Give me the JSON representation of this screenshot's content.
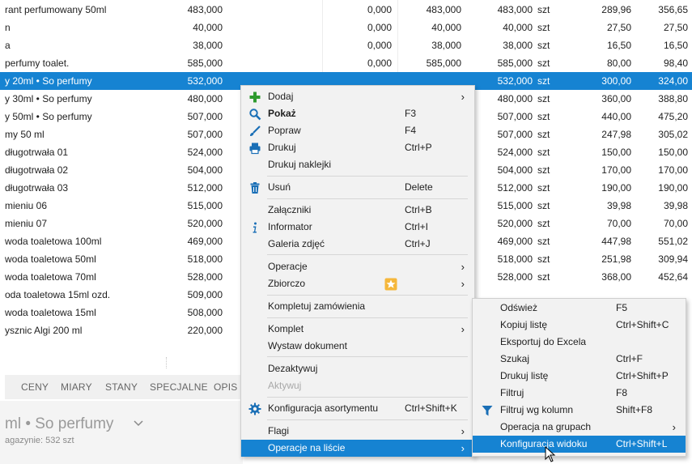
{
  "rows": [
    {
      "name": "rant perfumowany 50ml",
      "a": "483,000",
      "b": "0,000",
      "c": "483,000",
      "d": "483,000",
      "unit": "szt",
      "e": "289,96",
      "f": "356,65"
    },
    {
      "name": "n",
      "a": "40,000",
      "b": "0,000",
      "c": "40,000",
      "d": "40,000",
      "unit": "szt",
      "e": "27,50",
      "f": "27,50"
    },
    {
      "name": "a",
      "a": "38,000",
      "b": "0,000",
      "c": "38,000",
      "d": "38,000",
      "unit": "szt",
      "e": "16,50",
      "f": "16,50"
    },
    {
      "name": " perfumy toalet.",
      "a": "585,000",
      "b": "0,000",
      "c": "585,000",
      "d": "585,000",
      "unit": "szt",
      "e": "80,00",
      "f": "98,40"
    },
    {
      "name": "y 20ml  • So perfumy",
      "a": "532,000",
      "b": "",
      "c": "",
      "d": "532,000",
      "unit": "szt",
      "e": "300,00",
      "f": "324,00"
    },
    {
      "name": "y 30ml  • So perfumy",
      "a": "480,000",
      "b": "",
      "c": "",
      "d": "480,000",
      "unit": "szt",
      "e": "360,00",
      "f": "388,80"
    },
    {
      "name": "y 50ml  • So perfumy",
      "a": "507,000",
      "b": "",
      "c": "",
      "d": "507,000",
      "unit": "szt",
      "e": "440,00",
      "f": "475,20"
    },
    {
      "name": "my 50 ml",
      "a": "507,000",
      "b": "",
      "c": "",
      "d": "507,000",
      "unit": "szt",
      "e": "247,98",
      "f": "305,02"
    },
    {
      "name": "długotrwała 01",
      "a": "524,000",
      "b": "",
      "c": "",
      "d": "524,000",
      "unit": "szt",
      "e": "150,00",
      "f": "150,00"
    },
    {
      "name": "długotrwała 02",
      "a": "504,000",
      "b": "",
      "c": "",
      "d": "504,000",
      "unit": "szt",
      "e": "170,00",
      "f": "170,00"
    },
    {
      "name": "długotrwała 03",
      "a": "512,000",
      "b": "",
      "c": "",
      "d": "512,000",
      "unit": "szt",
      "e": "190,00",
      "f": "190,00"
    },
    {
      "name": " mieniu 06",
      "a": "515,000",
      "b": "",
      "c": "",
      "d": "515,000",
      "unit": "szt",
      "e": "39,98",
      "f": "39,98"
    },
    {
      "name": " mieniu 07",
      "a": "520,000",
      "b": "",
      "c": "",
      "d": "520,000",
      "unit": "szt",
      "e": "70,00",
      "f": "70,00"
    },
    {
      "name": " woda toaletowa 100ml",
      "a": "469,000",
      "b": "",
      "c": "",
      "d": "469,000",
      "unit": "szt",
      "e": "447,98",
      "f": "551,02"
    },
    {
      "name": " woda toaletowa 50ml",
      "a": "518,000",
      "b": "",
      "c": "",
      "d": "518,000",
      "unit": "szt",
      "e": "251,98",
      "f": "309,94"
    },
    {
      "name": " woda toaletowa 70ml",
      "a": "528,000",
      "b": "",
      "c": "",
      "d": "528,000",
      "unit": "szt",
      "e": "368,00",
      "f": "452,64"
    },
    {
      "name": "oda toaletowa 15ml ozd.",
      "a": "509,000",
      "b": "",
      "c": "",
      "d": "",
      "unit": "",
      "e": "",
      "f": ""
    },
    {
      "name": " woda toaletowa 15ml",
      "a": "508,000",
      "b": "",
      "c": "",
      "d": "",
      "unit": "",
      "e": "",
      "f": ""
    },
    {
      "name": "ysznic Algi 200 ml",
      "a": "220,000",
      "b": "",
      "c": "",
      "d": "",
      "unit": "",
      "e": "",
      "f": ""
    }
  ],
  "selected_row": 4,
  "tabs": [
    "CENY",
    "MIARY",
    "STANY",
    "SPECJALNE",
    "OPIS"
  ],
  "product": {
    "title": "ml  • So perfumy",
    "subtitle": "agazynie: 532 szt"
  },
  "menu1": {
    "items": [
      {
        "label": "Dodaj",
        "shortcut": "",
        "submenu": true,
        "icon": "plus-icon"
      },
      {
        "label": "Pokaż",
        "shortcut": "F3",
        "bold": true,
        "icon": "magnifier-icon"
      },
      {
        "label": "Popraw",
        "shortcut": "F4",
        "icon": "brush-icon"
      },
      {
        "label": "Drukuj",
        "shortcut": "Ctrl+P",
        "icon": "printer-icon"
      },
      {
        "label": "Drukuj naklejki",
        "shortcut": ""
      },
      {
        "label": "Usuń",
        "shortcut": "Delete",
        "icon": "trash-icon"
      },
      {
        "label": "Załączniki",
        "shortcut": "Ctrl+B"
      },
      {
        "label": "Informator",
        "shortcut": "Ctrl+I",
        "icon": "info-icon"
      },
      {
        "label": "Galeria zdjęć",
        "shortcut": "Ctrl+J"
      },
      {
        "label": "Operacje",
        "shortcut": "",
        "submenu": true
      },
      {
        "label": "Zbiorczo",
        "shortcut": "",
        "submenu": true,
        "icon": "star-badge-icon"
      },
      {
        "label": "Kompletuj zamówienia",
        "shortcut": ""
      },
      {
        "label": "Komplet",
        "shortcut": "",
        "submenu": true
      },
      {
        "label": "Wystaw dokument",
        "shortcut": ""
      },
      {
        "label": "Dezaktywuj",
        "shortcut": ""
      },
      {
        "label": "Aktywuj",
        "shortcut": "",
        "disabled": true
      },
      {
        "label": "Konfiguracja asortymentu",
        "shortcut": "Ctrl+Shift+K",
        "icon": "gear-icon"
      },
      {
        "label": "Flagi",
        "shortcut": "",
        "submenu": true
      },
      {
        "label": "Operacje na liście",
        "shortcut": "",
        "submenu": true,
        "highlighted": true
      }
    ]
  },
  "menu2": {
    "items": [
      {
        "label": "Odśwież",
        "shortcut": "F5"
      },
      {
        "label": "Kopiuj listę",
        "shortcut": "Ctrl+Shift+C"
      },
      {
        "label": "Eksportuj do Excela",
        "shortcut": ""
      },
      {
        "label": "Szukaj",
        "shortcut": "Ctrl+F"
      },
      {
        "label": "Drukuj listę",
        "shortcut": "Ctrl+Shift+P"
      },
      {
        "label": "Filtruj",
        "shortcut": "F8"
      },
      {
        "label": "Filtruj wg kolumn",
        "shortcut": "Shift+F8",
        "icon": "funnel-icon"
      },
      {
        "label": "Operacja na grupach",
        "shortcut": "",
        "submenu": true
      },
      {
        "label": "Konfiguracja widoku",
        "shortcut": "Ctrl+Shift+L",
        "highlighted": true
      }
    ]
  },
  "submenu_arrow": "›",
  "colors": {
    "selection": "#1683d2",
    "plus": "#2e9a2e",
    "icon_blue": "#1a6fb6",
    "star": "#f5b73b"
  }
}
